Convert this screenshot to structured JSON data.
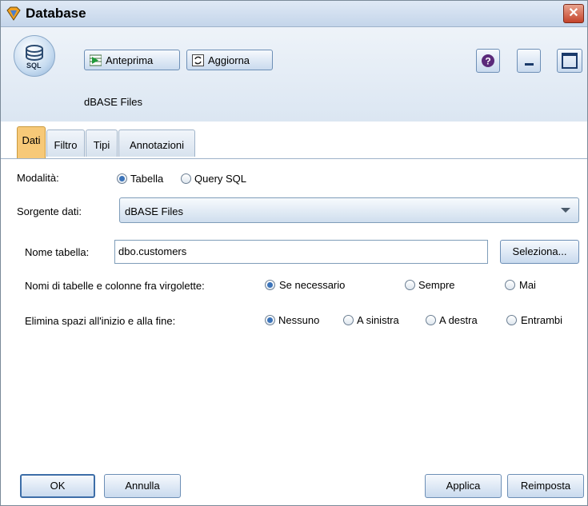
{
  "window": {
    "title": "Database"
  },
  "toolbar": {
    "preview_label": "Anteprima",
    "refresh_label": "Aggiorna",
    "help_icon": "help-icon",
    "minimize_icon": "minimize-icon",
    "maximize_icon": "maximize-icon"
  },
  "node": {
    "icon_text": "SQL",
    "label": "dBASE Files"
  },
  "tabs": [
    {
      "label": "Dati",
      "active": true
    },
    {
      "label": "Filtro",
      "active": false
    },
    {
      "label": "Tipi",
      "active": false
    },
    {
      "label": "Annotazioni",
      "active": false
    }
  ],
  "form": {
    "mode_label": "Modalità:",
    "mode_options": [
      {
        "label": "Tabella",
        "selected": true
      },
      {
        "label": "Query SQL",
        "selected": false
      }
    ],
    "source_label": "Sorgente dati:",
    "source_value": "dBASE Files",
    "table_label": "Nome tabella:",
    "table_value": "dbo.customers",
    "select_button": "Seleziona...",
    "quote_label": "Nomi di tabelle e colonne fra virgolette:",
    "quote_options": [
      {
        "label": "Se necessario",
        "selected": true
      },
      {
        "label": "Sempre",
        "selected": false
      },
      {
        "label": "Mai",
        "selected": false
      }
    ],
    "trim_label": "Elimina spazi all'inizio e alla fine:",
    "trim_options": [
      {
        "label": "Nessuno",
        "selected": true
      },
      {
        "label": "A sinistra",
        "selected": false
      },
      {
        "label": "A destra",
        "selected": false
      },
      {
        "label": "Entrambi",
        "selected": false
      }
    ]
  },
  "footer": {
    "ok": "OK",
    "cancel": "Annulla",
    "apply": "Applica",
    "reset": "Reimposta"
  },
  "colors": {
    "active_tab": "#f7c978",
    "close_button": "#c4432b",
    "accent": "#3b73b9"
  }
}
